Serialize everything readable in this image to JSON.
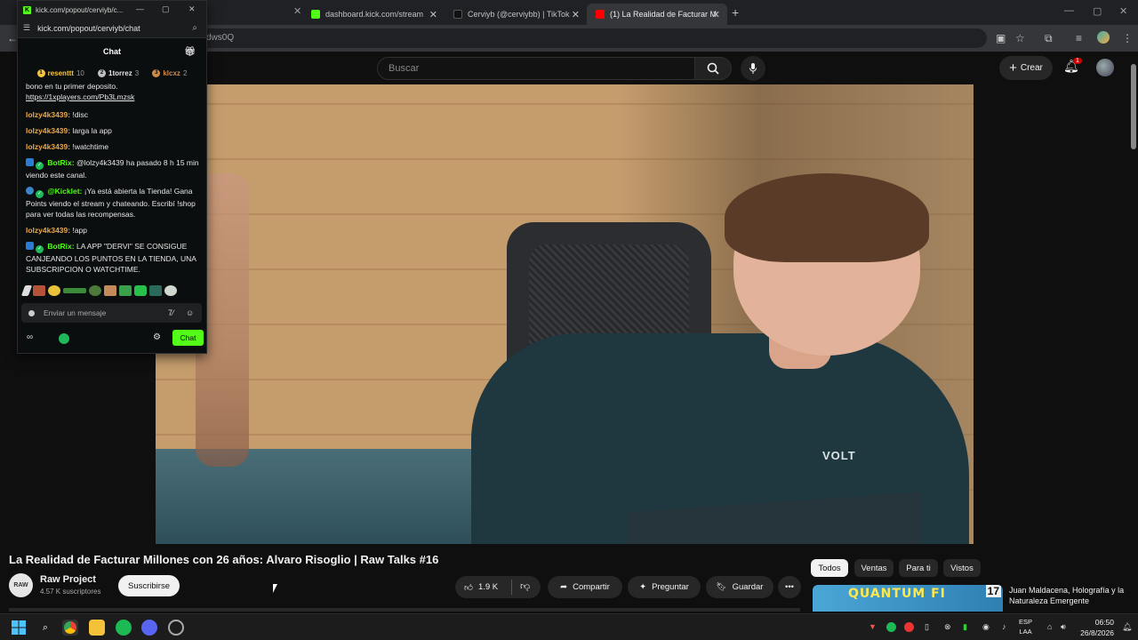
{
  "browser": {
    "tabs": [
      {
        "label": "dashboard.kick.com/stream",
        "favicon": "kick-icon",
        "color": "#53fc18"
      },
      {
        "label": "Cerviyb (@cerviybb) | TikTok",
        "favicon": "tiktok-icon",
        "color": "#111111"
      },
      {
        "label": "(1) La Realidad de Facturar M",
        "favicon": "youtube-icon",
        "color": "#ff0000"
      }
    ],
    "address_partial": "dws0Q"
  },
  "youtube": {
    "search_placeholder": "Buscar",
    "create_label": "Crear",
    "notifications_count": "1",
    "video_title": "La Realidad de Facturar Millones con 26 años: Alvaro Risoglio | Raw Talks #16",
    "channel_name": "Raw Project",
    "channel_avatar_text": "RAW",
    "subscribers": "4.57 K suscriptores",
    "subscribe_label": "Suscribirse",
    "likes": "1.9 K",
    "share_label": "Compartir",
    "ask_label": "Preguntar",
    "save_label": "Guardar",
    "filter_chips": [
      "Todos",
      "Ventas",
      "Para ti",
      "Vistos"
    ],
    "video_shirt_brand": "VOLT",
    "recommended": {
      "title": "Juan Maldacena, Holografía y la Naturaleza Emergente",
      "thumb_text": "QUANTUM FI",
      "thumb_number": "17"
    }
  },
  "popout": {
    "window_title": "kick.com/popout/cerviyb/c...",
    "url": "kick.com/popout/cerviyb/chat",
    "chat_title": "Chat",
    "leaderboard": [
      {
        "name": "resenttt",
        "count": "10",
        "rank": "1",
        "color": "#f5c542"
      },
      {
        "name": "1torrez",
        "count": "3",
        "rank": "2",
        "color": "#c0c0c0"
      },
      {
        "name": "klcxz",
        "count": "2",
        "rank": "3",
        "color": "#d08a4a"
      }
    ],
    "messages": [
      {
        "user": "",
        "text": "bono en tu primer deposito.",
        "user_color": "#e6e6e6"
      },
      {
        "user": "",
        "text": "https://1xplayers.com/Pb3Lmzsk",
        "link": true,
        "user_color": "#e6e6e6"
      },
      {
        "user": "lolzy4k3439:",
        "text": "!disc",
        "user_color": "#e8a84a"
      },
      {
        "user": "lolzy4k3439:",
        "text": "larga la app",
        "user_color": "#e8a84a"
      },
      {
        "user": "lolzy4k3439:",
        "text": "!watchtime",
        "user_color": "#e8a84a"
      },
      {
        "user": "BotRix:",
        "text": "@lolzy4k3439 ha pasado 8 h 15 min viendo este canal.",
        "user_color": "#53fc18",
        "bot": true
      },
      {
        "user": "@Kicklet:",
        "text": "¡Ya está abierta la Tienda! Gana Points viendo el stream y chateando. Escribí !shop para ver todas las recompensas.",
        "user_color": "#53fc18",
        "bot": true
      },
      {
        "user": "lolzy4k3439:",
        "text": "!app",
        "user_color": "#e8a84a"
      },
      {
        "user": "BotRix:",
        "text": "LA APP \"DERVI\" SE CONSIGUE CANJEANDO LOS PUNTOS EN LA TIENDA, UNA SUBSCRIPCION O WATCHTIME.",
        "user_color": "#53fc18",
        "bot": true
      }
    ],
    "input_placeholder": "Enviar un mensaje",
    "chat_button": "Chat"
  },
  "taskbar": {
    "lang_1": "ESP",
    "lang_2": "LAA",
    "time": "06:50",
    "date": "26/8/2026"
  },
  "colors": {
    "kick_green": "#53fc18",
    "youtube_bg": "#0f0f0f",
    "notification_red": "#cc0000"
  }
}
